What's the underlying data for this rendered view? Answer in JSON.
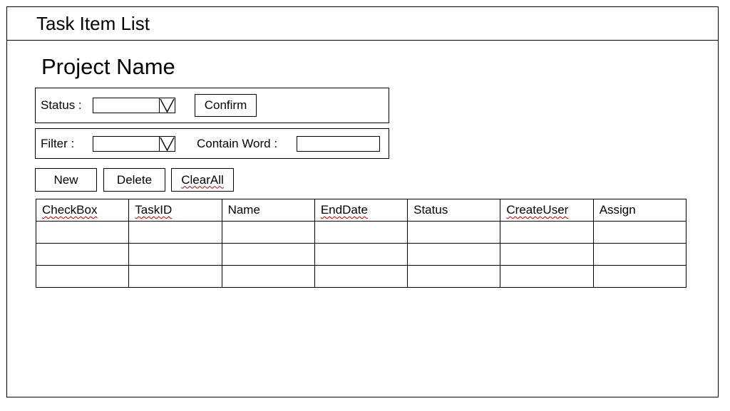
{
  "window": {
    "title": "Task Item List"
  },
  "project": {
    "name": "Project Name"
  },
  "status_panel": {
    "label": "Status :",
    "select_value": "",
    "confirm_label": "Confirm"
  },
  "filter_panel": {
    "label": "Filter :",
    "select_value": "",
    "contain_word_label": "Contain Word :",
    "contain_word_value": ""
  },
  "actions": {
    "new_label": "New",
    "delete_label": "Delete",
    "clear_all_label": "ClearAll"
  },
  "table": {
    "columns": [
      "CheckBox",
      "TaskID",
      "Name",
      "EndDate",
      "Status",
      "CreateUser",
      "Assign"
    ],
    "rows": [
      [
        "",
        "",
        "",
        "",
        "",
        "",
        ""
      ],
      [
        "",
        "",
        "",
        "",
        "",
        "",
        ""
      ],
      [
        "",
        "",
        "",
        "",
        "",
        "",
        ""
      ]
    ]
  },
  "icons": {
    "dropdown": "dropdown-arrow-icon"
  },
  "colors": {
    "border": "#000000",
    "background": "#ffffff",
    "spellcheck_underline": "#b00000"
  }
}
